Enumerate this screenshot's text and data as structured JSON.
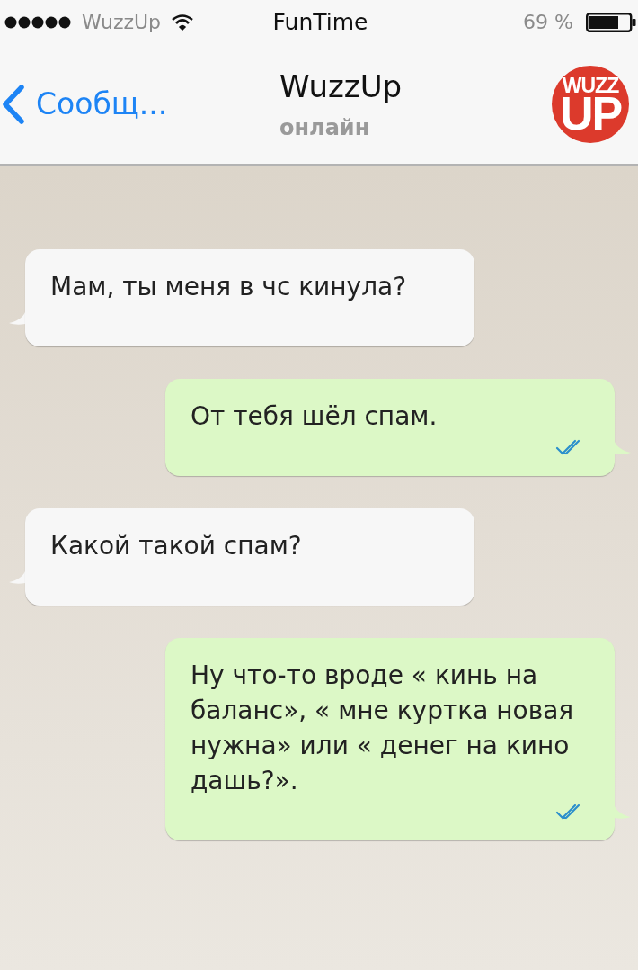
{
  "status_bar": {
    "carrier": "WuzzUp",
    "title": "FunTime",
    "battery": "69 %"
  },
  "header": {
    "back": "Сообщ...",
    "title": "WuzzUp",
    "subtitle": "онлайн",
    "logo": {
      "top": "WUZZ",
      "bottom": "UP"
    }
  },
  "messages": [
    {
      "kind": "incoming",
      "text": "Мам, ты меня в чс кинула?"
    },
    {
      "kind": "outgoing",
      "text": "От тебя шёл спам.",
      "read": true
    },
    {
      "kind": "incoming",
      "text": "Какой такой спам?"
    },
    {
      "kind": "outgoing",
      "text": "Ну что-то вроде « кинь на баланс», « мне куртка новая нужна» или « денег на кино дашь?».",
      "read": true
    }
  ]
}
